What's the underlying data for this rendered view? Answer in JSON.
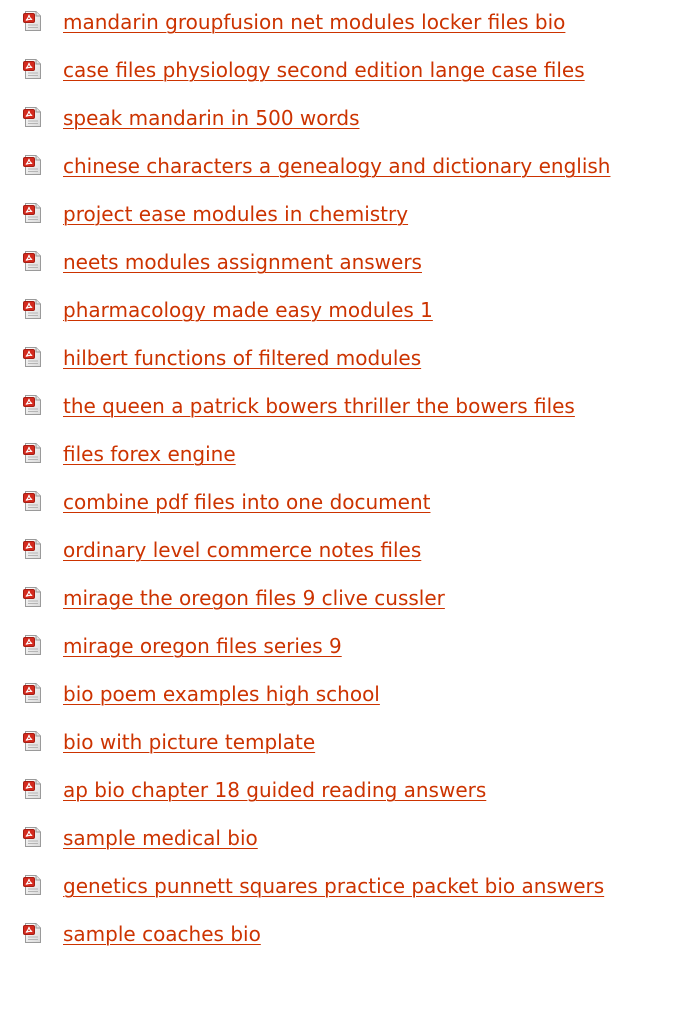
{
  "files": [
    {
      "title": "mandarin groupfusion net modules locker files bio",
      "icon": "pdf-file-icon"
    },
    {
      "title": "case files physiology second edition lange case files",
      "icon": "pdf-file-icon"
    },
    {
      "title": "speak mandarin in 500 words",
      "icon": "pdf-file-icon"
    },
    {
      "title": "chinese characters a genealogy and dictionary english",
      "icon": "pdf-file-icon"
    },
    {
      "title": "project ease modules in chemistry",
      "icon": "pdf-file-icon"
    },
    {
      "title": "neets modules assignment answers",
      "icon": "pdf-file-icon"
    },
    {
      "title": "pharmacology made easy modules 1",
      "icon": "pdf-file-icon"
    },
    {
      "title": "hilbert functions of filtered modules",
      "icon": "pdf-file-icon"
    },
    {
      "title": "the queen a patrick bowers thriller the bowers files",
      "icon": "pdf-file-icon"
    },
    {
      "title": "files forex engine",
      "icon": "pdf-file-icon"
    },
    {
      "title": "combine pdf files into one document",
      "icon": "pdf-file-icon"
    },
    {
      "title": "ordinary level commerce notes files",
      "icon": "pdf-file-icon"
    },
    {
      "title": "mirage the oregon files 9 clive cussler",
      "icon": "pdf-file-icon"
    },
    {
      "title": "mirage oregon files series 9",
      "icon": "pdf-file-icon"
    },
    {
      "title": "bio poem examples high school",
      "icon": "pdf-file-icon"
    },
    {
      "title": "bio with picture template",
      "icon": "pdf-file-icon"
    },
    {
      "title": "ap bio chapter 18 guided reading answers",
      "icon": "pdf-file-icon"
    },
    {
      "title": "sample medical bio",
      "icon": "pdf-file-icon"
    },
    {
      "title": "genetics punnett squares practice packet bio answers",
      "icon": "pdf-file-icon"
    },
    {
      "title": "sample coaches bio",
      "icon": "pdf-file-icon"
    }
  ],
  "colors": {
    "link": "#cc3300",
    "icon_red": "#d42a1e",
    "icon_page": "#f2f2f2",
    "icon_border": "#9a9a9a"
  }
}
